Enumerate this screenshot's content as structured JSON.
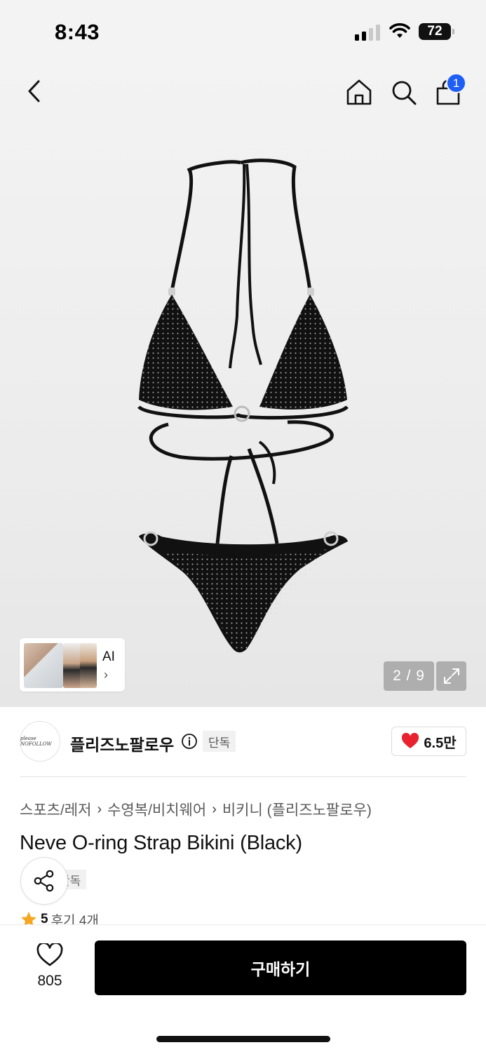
{
  "status_bar": {
    "time": "8:43",
    "battery": "72"
  },
  "header": {
    "cart_count": "1"
  },
  "gallery": {
    "counter": "2 / 9",
    "ai_label": "AI",
    "ai_chevron": "›"
  },
  "brand": {
    "logo_text": "please NOFOLLOW",
    "name": "플리즈노팔로우",
    "badge": "단독",
    "likes": "6.5만"
  },
  "breadcrumb": [
    "스포츠/레저",
    "수영복/비치웨어",
    "비키니 (플리즈노팔로우)"
  ],
  "breadcrumb_sep": "›",
  "product": {
    "title": "Neve O-ring Strap Bikini (Black)",
    "badge": "단독"
  },
  "rating": {
    "value": "5",
    "reviews": "후기 4개"
  },
  "action_bar": {
    "wish_count": "805",
    "buy_label": "구매하기"
  },
  "colors": {
    "accent": "#1d5ef5",
    "heart": "#e8232f",
    "star": "#f5a623"
  },
  "icons": [
    "back-icon",
    "home-icon",
    "search-icon",
    "bag-icon",
    "expand-icon",
    "info-icon",
    "heart-icon",
    "share-icon",
    "star-icon",
    "chevron-right-icon"
  ]
}
